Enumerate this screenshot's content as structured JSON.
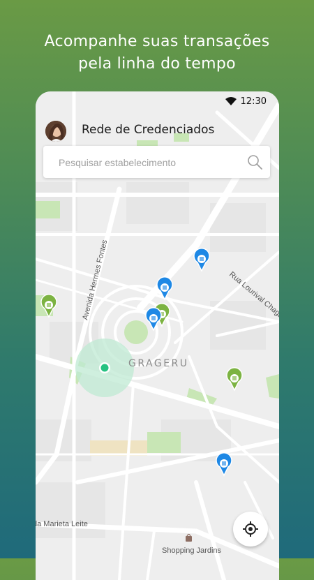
{
  "promo": {
    "line1": "Acompanhe suas transações",
    "line2": "pela linha do tempo"
  },
  "status_bar": {
    "time": "12:30"
  },
  "app_bar": {
    "title": "Rede de Credenciados"
  },
  "search": {
    "placeholder": "Pesquisar estabelecimento"
  },
  "map": {
    "labels": {
      "street1": "Avenida Hermes Fontes",
      "street2": "Rua Lourival Chagas",
      "neighborhood": "GRAGERU",
      "street3": "da Marieta Leite",
      "poi": "Shopping Jardins"
    },
    "pins_blue": 4,
    "pins_green": 3
  },
  "colors": {
    "pin_blue": "#1e88e5",
    "pin_green": "#7cb342",
    "user_location": "#26c281",
    "park_green": "#c8e6b5"
  }
}
